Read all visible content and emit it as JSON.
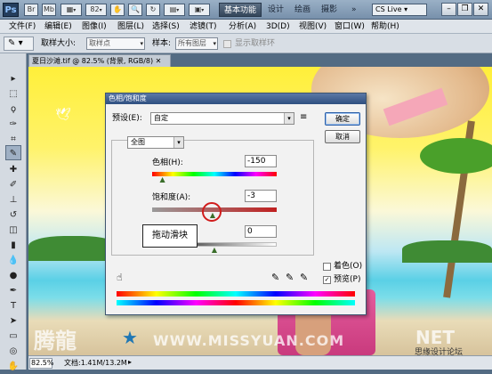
{
  "app": {
    "logo": "Ps",
    "workspaces": [
      "基本功能",
      "设计",
      "绘画",
      "摄影"
    ],
    "active_workspace": "基本功能",
    "more_icon": "»",
    "cs_live": "CS Live"
  },
  "menus": [
    "文件(F)",
    "编辑(E)",
    "图像(I)",
    "图层(L)",
    "选择(S)",
    "滤镜(T)",
    "分析(A)",
    "3D(D)",
    "视图(V)",
    "窗口(W)",
    "帮助(H)"
  ],
  "options": {
    "sample_size_label": "取样大小:",
    "sample_size_value": "取样点",
    "sample_label": "样本:",
    "sample_value": "所有图层",
    "show_ring_label": "显示取样环"
  },
  "document": {
    "tab_title": "夏日沙滩.tif @ 82.5% (背景, RGB/8)",
    "zoom": "82.5%",
    "doc_info": "文档:1.41M/13.2M"
  },
  "dialog": {
    "title": "色相/饱和度",
    "preset_label": "预设(E):",
    "preset_value": "自定",
    "ok": "确定",
    "cancel": "取消",
    "channel_value": "全图",
    "hue_label": "色相(H):",
    "hue_value": "-150",
    "saturation_label": "饱和度(A):",
    "saturation_value": "-3",
    "lightness_value": "0",
    "colorize_label": "着色(O)",
    "preview_label": "预览(P)",
    "colorize_checked": false,
    "preview_checked": true,
    "hue_slider_fraction": 0.083,
    "saturation_slider_fraction": 0.485,
    "lightness_slider_fraction": 0.5
  },
  "annotation": {
    "callout_text": "拖动滑块"
  },
  "watermark": {
    "left_text": "腾龍",
    "center_text": "WWW.MISSYUAN.COM",
    "right_text": "思缘设计论坛",
    "net_text": "NET"
  },
  "colors": {
    "accent_red": "#d11c1c",
    "titlebar_blue": "#2f4f80"
  }
}
